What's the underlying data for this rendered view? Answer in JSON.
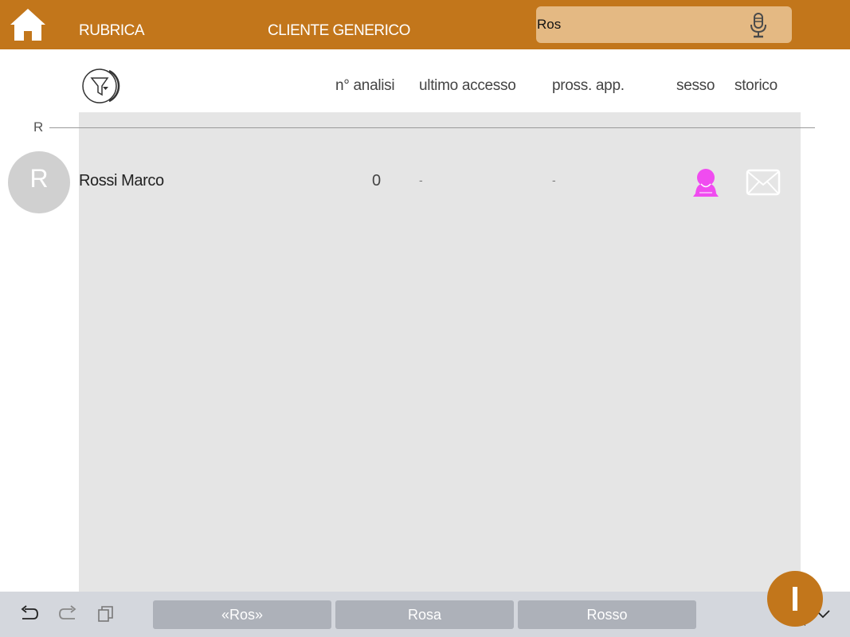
{
  "header": {
    "rubrica": "RUBRICA",
    "cliente": "CLIENTE GENERICO",
    "search_value": "Ros",
    "home_icon": "home-icon",
    "mic_icon": "microphone-icon",
    "brand_color": "#c2761b"
  },
  "columns": {
    "analisi": "n° analisi",
    "accesso": "ultimo accesso",
    "app": "pross. app.",
    "sesso": "sesso",
    "storico": "storico"
  },
  "section": {
    "letter": "R"
  },
  "contacts": [
    {
      "initial": "R",
      "name": "Rossi Marco",
      "analisi": "0",
      "ultimo_accesso": "-",
      "pross_app": "-",
      "sesso_icon": "female-icon",
      "storico_icon": "mail-icon"
    }
  ],
  "keyboard_bar": {
    "suggestions": [
      "«Ros»",
      "Rosa",
      "Rosso"
    ],
    "icons": [
      "undo-icon",
      "redo-icon",
      "paste-icon",
      "keyboard-dismiss-icon"
    ]
  },
  "fab_icon": "plus-icon"
}
